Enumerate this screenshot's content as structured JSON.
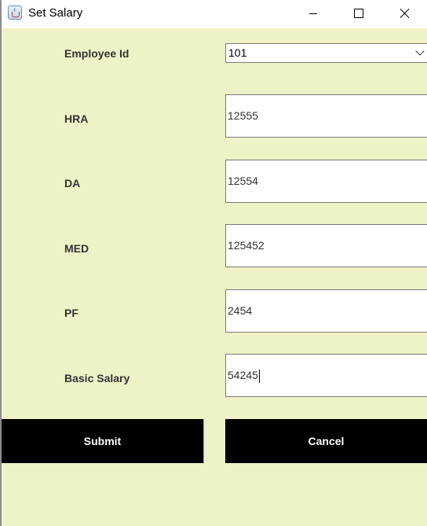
{
  "window": {
    "title": "Set Salary",
    "icon": "java-cup-icon"
  },
  "form": {
    "employee_id": {
      "label": "Employee Id",
      "value": "101"
    },
    "hra": {
      "label": "HRA",
      "value": "12555"
    },
    "da": {
      "label": "DA",
      "value": "12554"
    },
    "med": {
      "label": "MED",
      "value": "125452"
    },
    "pf": {
      "label": "PF",
      "value": "2454"
    },
    "basic_salary": {
      "label": "Basic Salary",
      "value": "54245"
    }
  },
  "buttons": {
    "submit": "Submit",
    "cancel": "Cancel"
  },
  "colors": {
    "background": "#eff2c6",
    "button": "#000000",
    "button_text": "#ffffff"
  }
}
